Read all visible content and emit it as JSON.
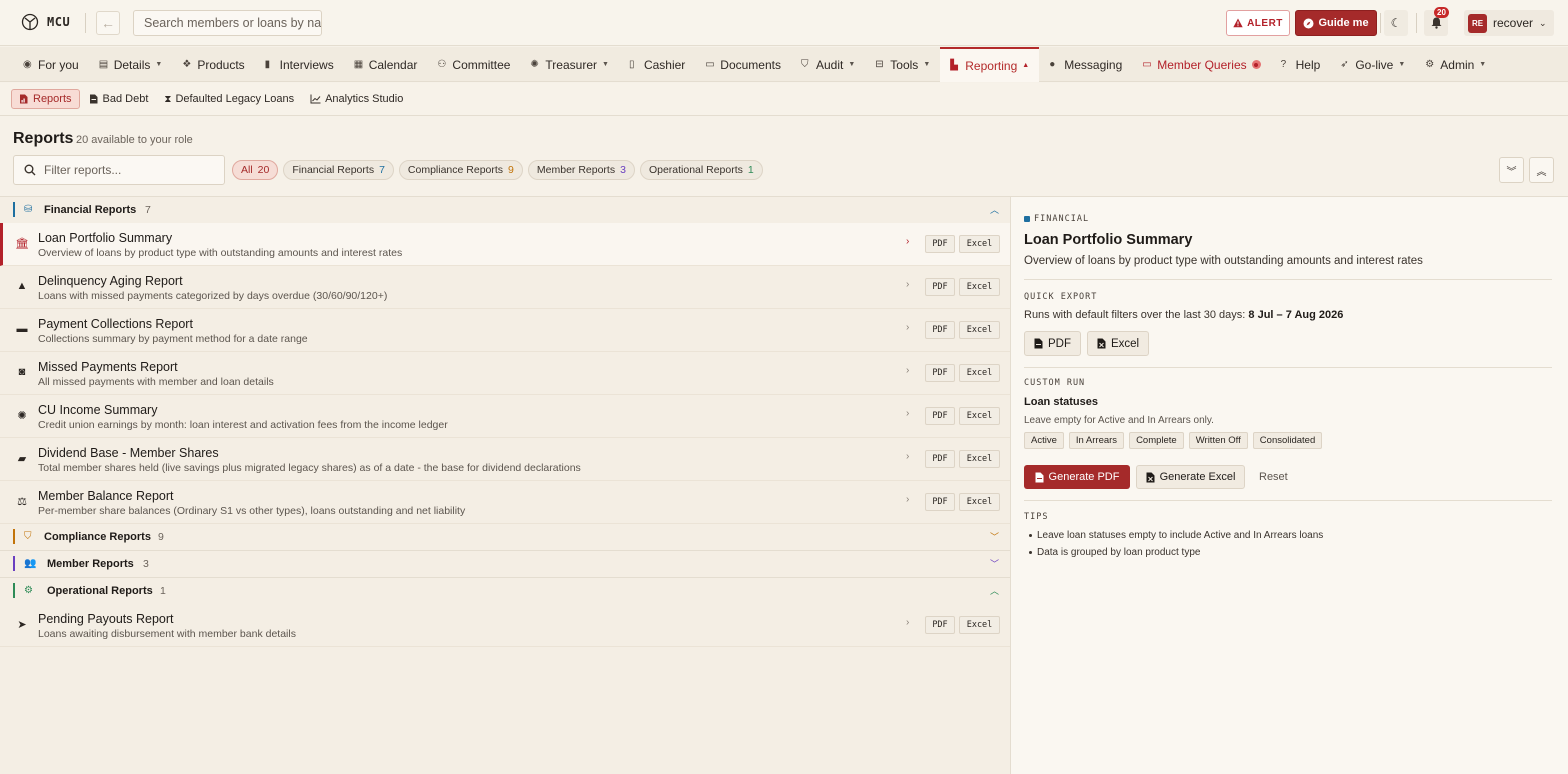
{
  "app": {
    "name": "MCU",
    "search_placeholder": "Search members or loans by name",
    "alert_label": "ALERT",
    "guide_label": "Guide me",
    "notification_count": "20",
    "user_initials": "RE",
    "user_name": "recover"
  },
  "nav": {
    "items": [
      {
        "label": "For you",
        "icon": "user-circle-icon"
      },
      {
        "label": "Details",
        "icon": "list-icon",
        "dropdown": true
      },
      {
        "label": "Products",
        "icon": "cubes-icon"
      },
      {
        "label": "Interviews",
        "icon": "clipboard-icon"
      },
      {
        "label": "Calendar",
        "icon": "calendar-icon"
      },
      {
        "label": "Committee",
        "icon": "users-icon"
      },
      {
        "label": "Treasurer",
        "icon": "piggy-bank-icon",
        "dropdown": true
      },
      {
        "label": "Cashier",
        "icon": "receipt-icon"
      },
      {
        "label": "Documents",
        "icon": "folder-icon"
      },
      {
        "label": "Audit",
        "icon": "shield-icon",
        "dropdown": true
      },
      {
        "label": "Tools",
        "icon": "toolbox-icon",
        "dropdown": true
      },
      {
        "label": "Reporting",
        "icon": "file-chart-icon",
        "dropdown": true,
        "active": true
      },
      {
        "label": "Messaging",
        "icon": "chat-icon"
      },
      {
        "label": "Member Queries",
        "icon": "inbox-icon",
        "highlight": true
      },
      {
        "label": "Help",
        "icon": "help-icon"
      },
      {
        "label": "Go-live",
        "icon": "rocket-icon",
        "dropdown": true
      },
      {
        "label": "Admin",
        "icon": "user-cog-icon",
        "dropdown": true
      }
    ]
  },
  "subnav": {
    "items": [
      {
        "label": "Reports",
        "active": true
      },
      {
        "label": "Bad Debt"
      },
      {
        "label": "Defaulted Legacy Loans"
      },
      {
        "label": "Analytics Studio"
      }
    ]
  },
  "reports": {
    "title": "Reports",
    "subtitle": "20 available to your role",
    "filter_placeholder": "Filter reports...",
    "chips": [
      {
        "label": "All",
        "count": "20"
      },
      {
        "label": "Financial Reports",
        "count": "7"
      },
      {
        "label": "Compliance Reports",
        "count": "9"
      },
      {
        "label": "Member Reports",
        "count": "3"
      },
      {
        "label": "Operational Reports",
        "count": "1"
      }
    ],
    "sections": {
      "financial": {
        "title": "Financial Reports",
        "count": "7"
      },
      "compliance": {
        "title": "Compliance Reports",
        "count": "9"
      },
      "member": {
        "title": "Member Reports",
        "count": "3"
      },
      "operational": {
        "title": "Operational Reports",
        "count": "1"
      }
    },
    "pdf_label": "PDF",
    "excel_label": "Excel",
    "financial_rows": [
      {
        "title": "Loan Portfolio Summary",
        "desc": "Overview of loans by product type with outstanding amounts and interest rates",
        "icon": "bank-icon"
      },
      {
        "title": "Delinquency Aging Report",
        "desc": "Loans with missed payments categorized by days overdue (30/60/90/120+)",
        "icon": "warning-icon"
      },
      {
        "title": "Payment Collections Report",
        "desc": "Collections summary by payment method for a date range",
        "icon": "credit-card-icon"
      },
      {
        "title": "Missed Payments Report",
        "desc": "All missed payments with member and loan details",
        "icon": "money-icon"
      },
      {
        "title": "CU Income Summary",
        "desc": "Credit union earnings by month: loan interest and activation fees from the income ledger",
        "icon": "piggy-bank-icon"
      },
      {
        "title": "Dividend Base - Member Shares",
        "desc": "Total member shares held (live savings plus migrated legacy shares) as of a date - the base for dividend declarations",
        "icon": "wallet-icon"
      },
      {
        "title": "Member Balance Report",
        "desc": "Per-member share balances (Ordinary S1 vs other types), loans outstanding and net liability",
        "icon": "scale-icon"
      }
    ],
    "operational_rows": [
      {
        "title": "Pending Payouts Report",
        "desc": "Loans awaiting disbursement with member bank details",
        "icon": "send-icon"
      }
    ]
  },
  "detail": {
    "category": "FINANCIAL",
    "title": "Loan Portfolio Summary",
    "desc": "Overview of loans by product type with outstanding amounts and interest rates",
    "quick_export_label": "QUICK EXPORT",
    "runs_text": "Runs with default filters over the last 30 days:",
    "runs_range": "8 Jul – 7 Aug 2026",
    "pdf_label": "PDF",
    "excel_label": "Excel",
    "custom_run_label": "CUSTOM RUN",
    "statuses_label": "Loan statuses",
    "statuses_hint": "Leave empty for Active and In Arrears only.",
    "statuses": [
      "Active",
      "In Arrears",
      "Complete",
      "Written Off",
      "Consolidated"
    ],
    "generate_pdf": "Generate PDF",
    "generate_excel": "Generate Excel",
    "reset": "Reset",
    "tips_label": "TIPS",
    "tips": [
      "Leave loan statuses empty to include Active and In Arrears loans",
      "Data is grouped by loan product type"
    ]
  },
  "colors": {
    "accent": "#a52a2a",
    "financial": "#1e6fa0",
    "compliance": "#c2740a",
    "member": "#6a3fc0",
    "operational": "#2e8b57"
  }
}
